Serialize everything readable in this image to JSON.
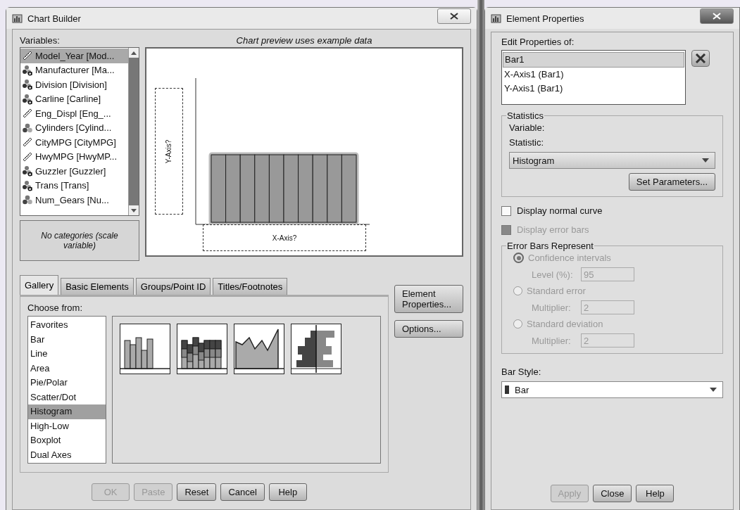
{
  "chart_builder": {
    "title": "Chart Builder",
    "variables_label": "Variables:",
    "variables": [
      {
        "name": "Model_Year [Mod...",
        "kind": "scale",
        "selected": true
      },
      {
        "name": "Manufacturer [Ma...",
        "kind": "nominal",
        "selected": false
      },
      {
        "name": "Division [Division]",
        "kind": "nominal",
        "selected": false
      },
      {
        "name": "Carline [Carline]",
        "kind": "nominal",
        "selected": false
      },
      {
        "name": "Eng_Displ [Eng_...",
        "kind": "scale",
        "selected": false
      },
      {
        "name": "Cylinders [Cylind...",
        "kind": "ordinal",
        "selected": false
      },
      {
        "name": "CityMPG [CityMPG]",
        "kind": "scale",
        "selected": false
      },
      {
        "name": "HwyMPG [HwyMP...",
        "kind": "scale",
        "selected": false
      },
      {
        "name": "Guzzler [Guzzler]",
        "kind": "nominal",
        "selected": false
      },
      {
        "name": "Trans [Trans]",
        "kind": "nominal",
        "selected": false
      },
      {
        "name": "Num_Gears [Nu...",
        "kind": "ordinal",
        "selected": false
      }
    ],
    "categories_note": "No categories (scale variable)",
    "preview_caption": "Chart preview uses example data",
    "y_axis_drop": "Y-Axis?",
    "x_axis_drop": "X-Axis?",
    "tabs": [
      {
        "label": "Gallery",
        "selected": true
      },
      {
        "label": "Basic Elements",
        "selected": false
      },
      {
        "label": "Groups/Point ID",
        "selected": false
      },
      {
        "label": "Titles/Footnotes",
        "selected": false
      }
    ],
    "choose_label": "Choose from:",
    "chart_types": [
      {
        "label": "Favorites",
        "selected": false
      },
      {
        "label": "Bar",
        "selected": false
      },
      {
        "label": "Line",
        "selected": false
      },
      {
        "label": "Area",
        "selected": false
      },
      {
        "label": "Pie/Polar",
        "selected": false
      },
      {
        "label": "Scatter/Dot",
        "selected": false
      },
      {
        "label": "Histogram",
        "selected": true
      },
      {
        "label": "High-Low",
        "selected": false
      },
      {
        "label": "Boxplot",
        "selected": false
      },
      {
        "label": "Dual Axes",
        "selected": false
      }
    ],
    "gallery": [
      {
        "kind": "simple"
      },
      {
        "kind": "stacked"
      },
      {
        "kind": "polygon"
      },
      {
        "kind": "pyramid"
      }
    ],
    "side_buttons": [
      {
        "label": "Element Properties..."
      },
      {
        "label": "Options..."
      }
    ],
    "buttons": [
      {
        "label": "OK",
        "disabled": true
      },
      {
        "label": "Paste",
        "disabled": true
      },
      {
        "label": "Reset",
        "disabled": false
      },
      {
        "label": "Cancel",
        "disabled": false
      },
      {
        "label": "Help",
        "disabled": false
      }
    ]
  },
  "element_properties": {
    "title": "Element Properties",
    "edit_label": "Edit Properties of:",
    "elements": [
      {
        "label": "Bar1",
        "selected": true
      },
      {
        "label": "X-Axis1 (Bar1)",
        "selected": false
      },
      {
        "label": "Y-Axis1 (Bar1)",
        "selected": false
      }
    ],
    "statistics": {
      "legend": "Statistics",
      "variable_label": "Variable:",
      "statistic_label": "Statistic:",
      "statistic": "Histogram",
      "set_parameters": "Set Parameters..."
    },
    "checkboxes": [
      {
        "label": "Display normal curve",
        "checked": false,
        "disabled": false
      },
      {
        "label": "Display error bars",
        "checked": false,
        "disabled": true
      }
    ],
    "error_bars": {
      "legend": "Error Bars Represent",
      "disabled": true,
      "options": [
        {
          "label": "Confidence intervals",
          "selected": true,
          "field_label": "Level (%):",
          "value": "95"
        },
        {
          "label": "Standard error",
          "selected": false,
          "field_label": "Multiplier:",
          "value": "2"
        },
        {
          "label": "Standard deviation",
          "selected": false,
          "field_label": "Multiplier:",
          "value": "2"
        }
      ]
    },
    "bar_style_label": "Bar Style:",
    "bar_style": "Bar",
    "buttons": [
      {
        "label": "Apply",
        "disabled": true
      },
      {
        "label": "Close",
        "disabled": false
      },
      {
        "label": "Help",
        "disabled": false
      }
    ]
  }
}
